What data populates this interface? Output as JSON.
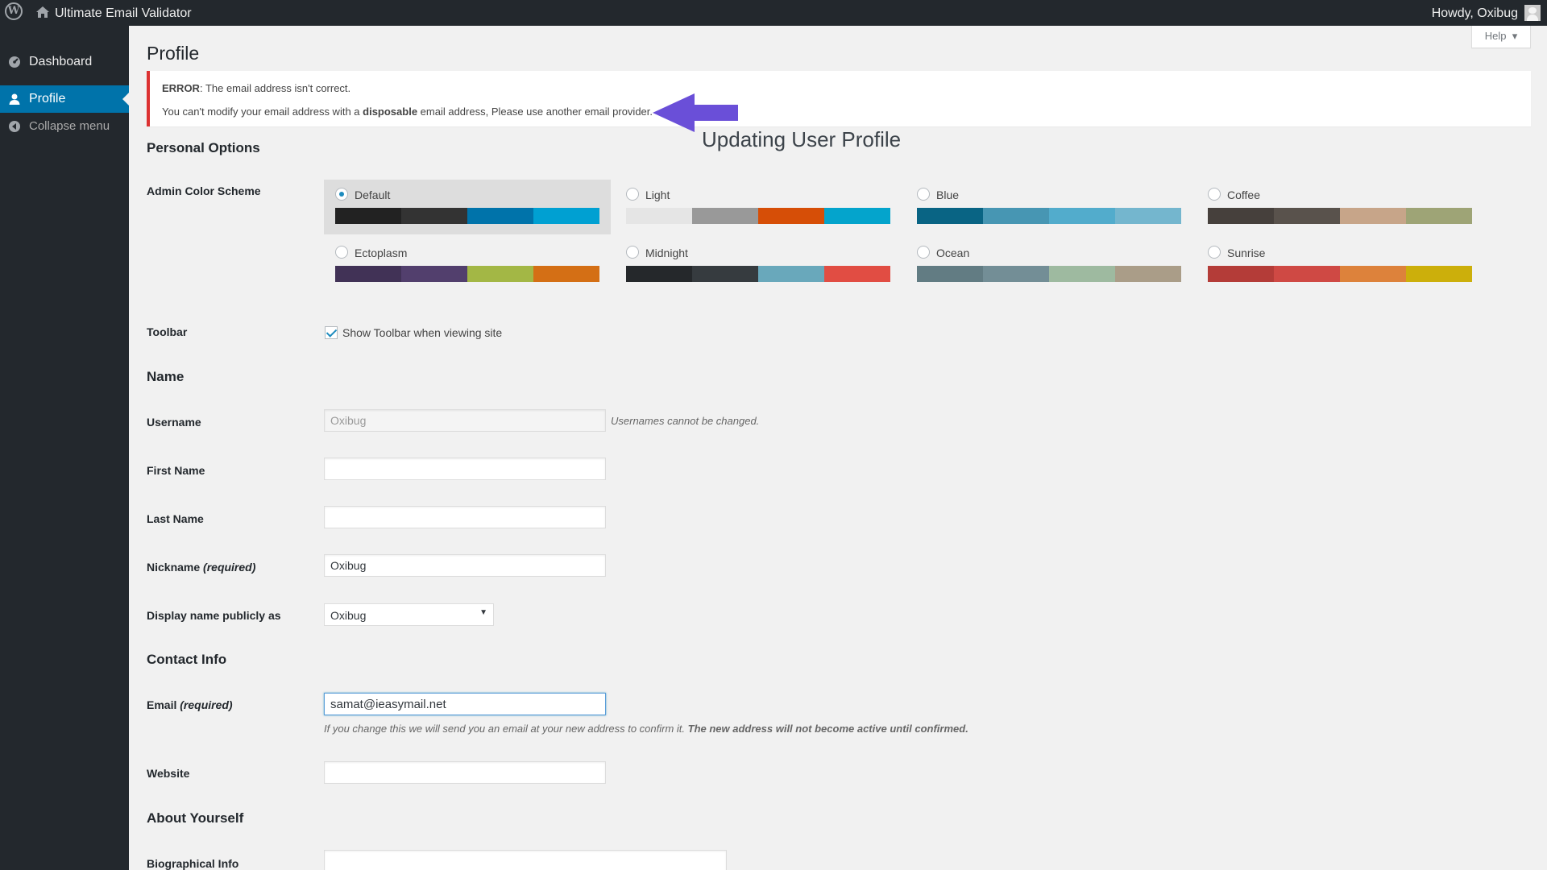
{
  "adminbar": {
    "site_name": "Ultimate Email Validator",
    "howdy": "Howdy, Oxibug"
  },
  "sidebar": {
    "items": [
      {
        "label": "Dashboard",
        "icon": "dashboard-icon"
      },
      {
        "label": "Profile",
        "icon": "user-icon",
        "current": true
      },
      {
        "label": "Collapse menu",
        "icon": "collapse-icon"
      }
    ]
  },
  "help": {
    "label": "Help"
  },
  "page": {
    "title": "Profile"
  },
  "notice": {
    "error_prefix": "ERROR",
    "error_text": ": The email address isn't correct.",
    "line2_a": "You can't modify your email address with a ",
    "line2_bold": "disposable",
    "line2_b": " email address, Please use another email provider."
  },
  "overlay": {
    "title": "Updating User Profile"
  },
  "personal_options": {
    "heading": "Personal Options",
    "color_scheme_label": "Admin Color Scheme",
    "schemes": [
      {
        "name": "Default",
        "colors": [
          "#222222",
          "#333333",
          "#0073aa",
          "#00a0d2"
        ],
        "selected": true
      },
      {
        "name": "Light",
        "colors": [
          "#e5e5e5",
          "#999999",
          "#d64e07",
          "#04a4cc"
        ]
      },
      {
        "name": "Blue",
        "colors": [
          "#096484",
          "#4796b3",
          "#52accc",
          "#74b6ce"
        ]
      },
      {
        "name": "Coffee",
        "colors": [
          "#46403c",
          "#59524c",
          "#c7a589",
          "#9ea476"
        ]
      },
      {
        "name": "Ectoplasm",
        "colors": [
          "#413256",
          "#523f6d",
          "#a3b745",
          "#d46f15"
        ]
      },
      {
        "name": "Midnight",
        "colors": [
          "#25282b",
          "#363b3f",
          "#69a8bb",
          "#e14d43"
        ]
      },
      {
        "name": "Ocean",
        "colors": [
          "#627c83",
          "#738e96",
          "#9ebaa0",
          "#aa9d88"
        ]
      },
      {
        "name": "Sunrise",
        "colors": [
          "#b43c38",
          "#cf4944",
          "#dd823b",
          "#ccaf0b"
        ]
      }
    ],
    "toolbar_label": "Toolbar",
    "toolbar_checkbox": "Show Toolbar when viewing site",
    "toolbar_checked": true
  },
  "name_section": {
    "heading": "Name",
    "username_label": "Username",
    "username_value": "Oxibug",
    "username_desc": "Usernames cannot be changed.",
    "first_name_label": "First Name",
    "first_name_value": "",
    "last_name_label": "Last Name",
    "last_name_value": "",
    "nickname_label": "Nickname",
    "nickname_required": "(required)",
    "nickname_value": "Oxibug",
    "display_name_label": "Display name publicly as",
    "display_name_value": "Oxibug"
  },
  "contact": {
    "heading": "Contact Info",
    "email_label": "Email",
    "email_required": "(required)",
    "email_value": "samat@ieasymail.net",
    "email_desc_a": "If you change this we will send you an email at your new address to confirm it. ",
    "email_desc_bold": "The new address will not become active until confirmed.",
    "website_label": "Website",
    "website_value": ""
  },
  "about": {
    "heading": "About Yourself",
    "bio_label": "Biographical Info"
  }
}
